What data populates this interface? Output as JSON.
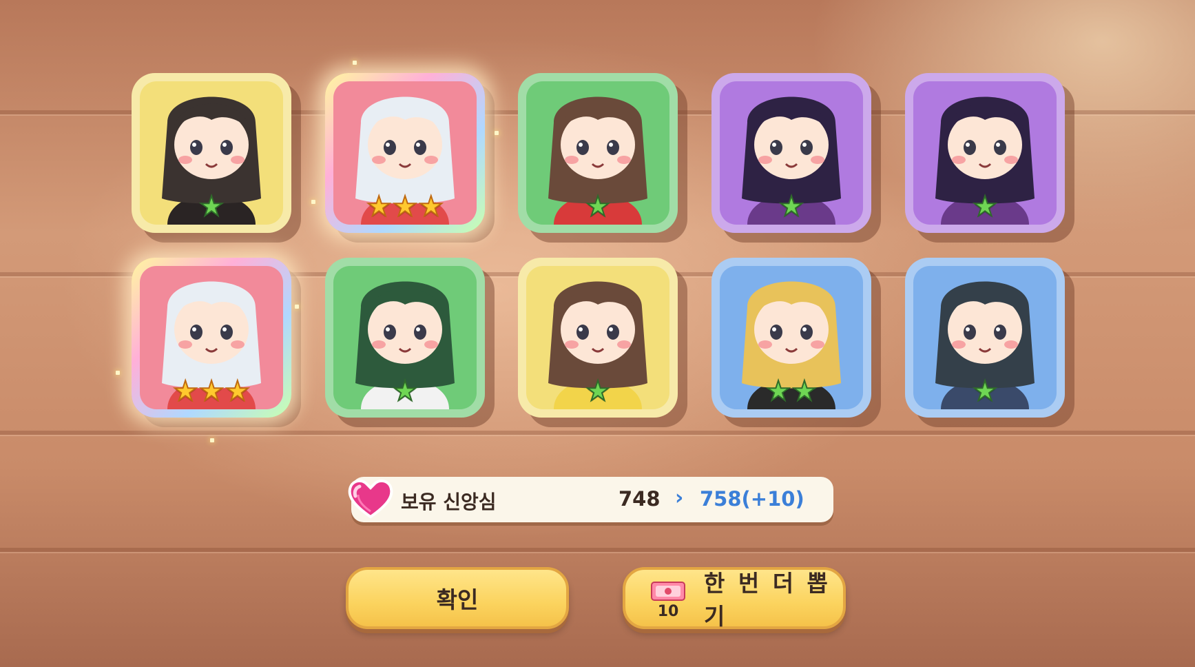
{
  "cards": [
    {
      "bg": "#f3df7a",
      "stars": 1,
      "tier": "normal",
      "hair": "#3b3330",
      "accent": "#2a2424",
      "icon": "cat-ear-girl-portrait"
    },
    {
      "bg": "#f28a9a",
      "stars": 3,
      "tier": "legendary",
      "hair": "#e8eef4",
      "accent": "#e24a4a",
      "icon": "white-hair-maid-portrait"
    },
    {
      "bg": "#6fcb78",
      "stars": 1,
      "tier": "normal",
      "hair": "#6a4a3a",
      "accent": "#d83a3a",
      "icon": "headband-girl-portrait"
    },
    {
      "bg": "#b07ae0",
      "stars": 1,
      "tier": "normal",
      "hair": "#2e2244",
      "accent": "#6a3a8a",
      "icon": "dark-hair-girl-portrait"
    },
    {
      "bg": "#b07ae0",
      "stars": 1,
      "tier": "normal",
      "hair": "#2e2244",
      "accent": "#6a3a8a",
      "icon": "dark-hair-girl-portrait"
    },
    {
      "bg": "#f28a9a",
      "stars": 3,
      "tier": "legendary",
      "hair": "#e8eef4",
      "accent": "#e24a4a",
      "icon": "white-hair-maid-portrait"
    },
    {
      "bg": "#6fcb78",
      "stars": 1,
      "tier": "normal",
      "hair": "#2d5a3c",
      "accent": "#f2f2f2",
      "icon": "skull-hat-girl-portrait"
    },
    {
      "bg": "#f3df7a",
      "stars": 1,
      "tier": "normal",
      "hair": "#6a4a3a",
      "accent": "#f2d44a",
      "icon": "carrot-girl-portrait"
    },
    {
      "bg": "#7eb0ec",
      "stars": 2,
      "tier": "normal",
      "hair": "#e8c25a",
      "accent": "#2a2a2a",
      "icon": "blonde-girl-portrait"
    },
    {
      "bg": "#7eb0ec",
      "stars": 1,
      "tier": "normal",
      "hair": "#34404a",
      "accent": "#3a4a6a",
      "icon": "bandana-girl-portrait"
    }
  ],
  "faith": {
    "label": "보유 신앙심",
    "current": "748",
    "arrow": "›",
    "next": "758(+10)"
  },
  "buttons": {
    "confirm": "확인",
    "redraw": "한 번 더 뽑기",
    "ticket_count": "10"
  },
  "colors": {
    "button": "#fbd35e",
    "faith_new": "#3b7fd8",
    "star_green": "#6fd654",
    "star_gold": "#ffc92e"
  }
}
